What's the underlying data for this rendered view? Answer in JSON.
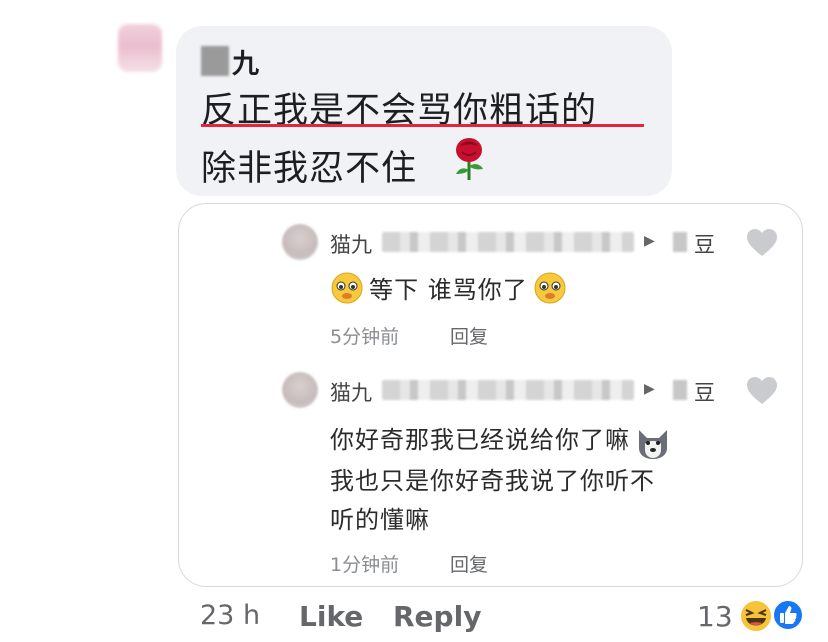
{
  "comment": {
    "author_suffix": "九",
    "line1": "反正我是不会骂你粗话的",
    "line2": "除非我忍不住",
    "emoji": "rose-icon"
  },
  "replies": [
    {
      "author": "猫九",
      "target": "豆",
      "text_lines": [
        "等下 谁骂你了"
      ],
      "time": "5分钟前",
      "reply_label": "回复"
    },
    {
      "author": "猫九",
      "target": "豆",
      "text_lines": [
        "你好奇那我已经说给你了嘛",
        "我也只是你好奇我说了你听不",
        "听的懂嘛"
      ],
      "time": "1分钟前",
      "reply_label": "回复"
    }
  ],
  "footer": {
    "time": "23 h",
    "like_label": "Like",
    "reply_label": "Reply",
    "reaction_count": "13",
    "reactions": [
      "haha-icon",
      "like-icon"
    ]
  },
  "colors": {
    "bubble_bg": "#f0f2f5",
    "underline": "#e4253a",
    "meta_text": "#65676b",
    "like_blue": "#1877f2"
  }
}
